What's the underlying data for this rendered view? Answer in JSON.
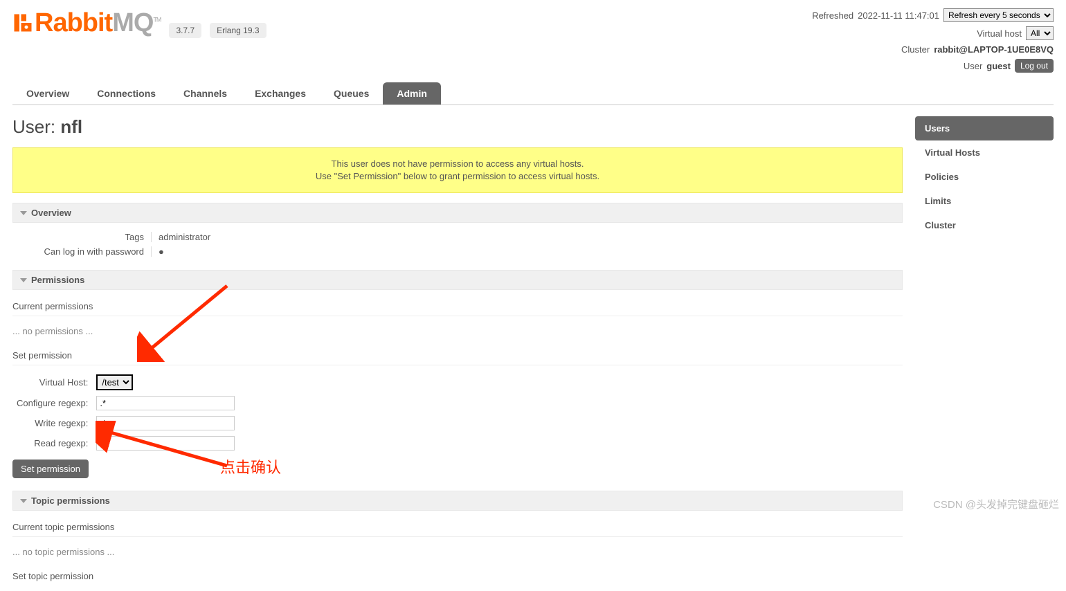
{
  "header": {
    "logo_text1": "Rabbit",
    "logo_text2": "MQ",
    "tm": "TM",
    "version": "3.7.7",
    "erlang": "Erlang 19.3",
    "refreshed_label": "Refreshed",
    "refreshed_time": "2022-11-11 11:47:01",
    "refresh_select": "Refresh every 5 seconds",
    "vhost_label": "Virtual host",
    "vhost_select": "All",
    "cluster_label": "Cluster",
    "cluster_value": "rabbit@LAPTOP-1UE0E8VQ",
    "user_label": "User",
    "user_value": "guest",
    "logout": "Log out"
  },
  "nav": {
    "overview": "Overview",
    "connections": "Connections",
    "channels": "Channels",
    "exchanges": "Exchanges",
    "queues": "Queues",
    "admin": "Admin"
  },
  "sidebar": {
    "users": "Users",
    "vhosts": "Virtual Hosts",
    "policies": "Policies",
    "limits": "Limits",
    "cluster": "Cluster"
  },
  "page": {
    "title_prefix": "User: ",
    "title_value": "nfl",
    "warning_line1": "This user does not have permission to access any virtual hosts.",
    "warning_line2": "Use \"Set Permission\" below to grant permission to access virtual hosts."
  },
  "overview_section": {
    "header": "Overview",
    "tags_label": "Tags",
    "tags_value": "administrator",
    "login_label": "Can log in with password",
    "login_value": "●"
  },
  "permissions_section": {
    "header": "Permissions",
    "current_label": "Current permissions",
    "none_text": "... no permissions ...",
    "set_label": "Set permission",
    "vhost_label": "Virtual Host:",
    "vhost_value": "/test",
    "configure_label": "Configure regexp:",
    "configure_value": ".*",
    "write_label": "Write regexp:",
    "write_value": ".*",
    "read_label": "Read regexp:",
    "read_value": ".*",
    "button": "Set permission"
  },
  "topic_section": {
    "header": "Topic permissions",
    "current_label": "Current topic permissions",
    "none_text": "... no topic permissions ...",
    "set_label": "Set topic permission"
  },
  "annotations": {
    "click_confirm": "点击确认",
    "watermark": "CSDN @头发掉完键盘砸烂"
  }
}
